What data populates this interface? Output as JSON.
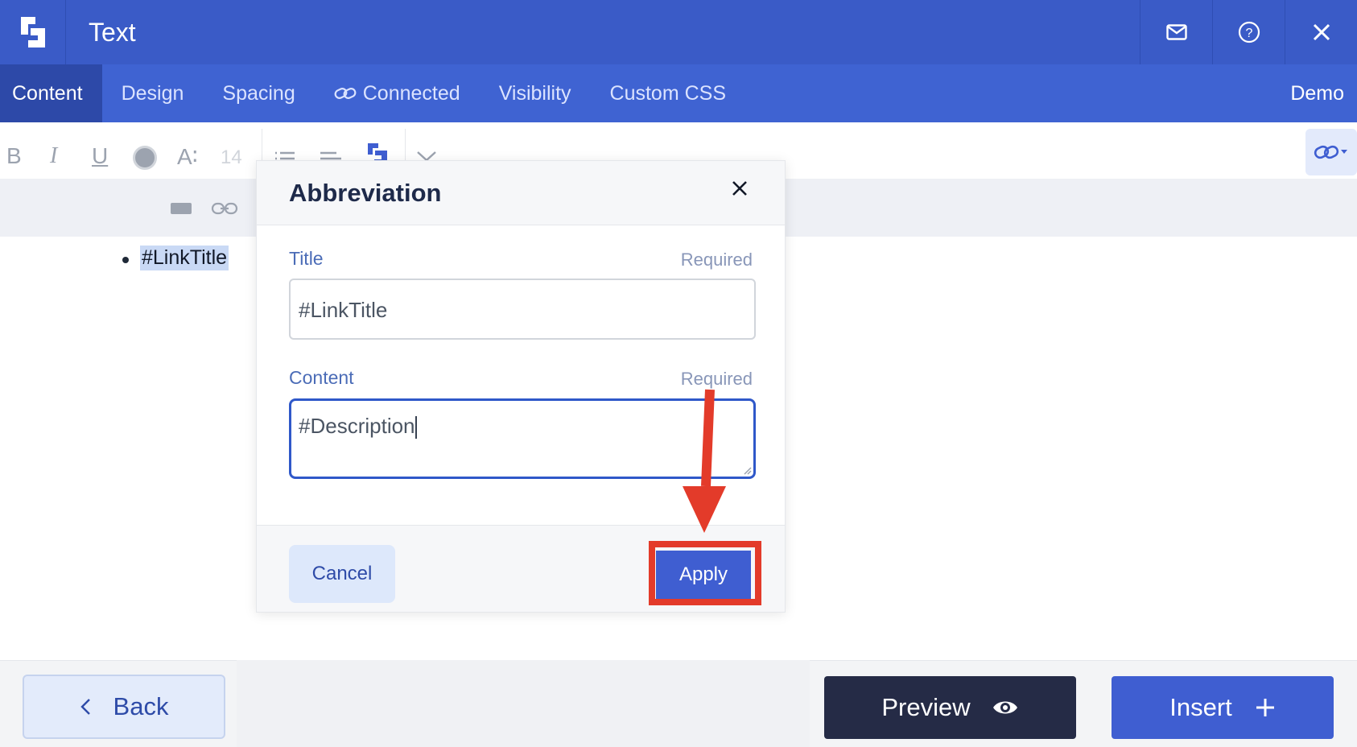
{
  "header": {
    "title": "Text"
  },
  "tabs": [
    {
      "label": "Content"
    },
    {
      "label": "Design"
    },
    {
      "label": "Spacing"
    },
    {
      "label": "Connected"
    },
    {
      "label": "Visibility"
    },
    {
      "label": "Custom CSS"
    }
  ],
  "tab_right": "Demo",
  "toolbar": {
    "bold": "B",
    "italic": "I",
    "underline": "U",
    "font_size_glyph": "A∶",
    "font_size_value": "14"
  },
  "editor": {
    "selected_text": "#LinkTitle"
  },
  "modal": {
    "title": "Abbreviation",
    "title_field": {
      "label": "Title",
      "required": "Required",
      "value": "#LinkTitle"
    },
    "content_field": {
      "label": "Content",
      "required": "Required",
      "value": "#Description"
    },
    "cancel_label": "Cancel",
    "apply_label": "Apply"
  },
  "footer": {
    "back_label": "Back",
    "preview_label": "Preview",
    "insert_label": "Insert"
  },
  "colors": {
    "header": "#3a5bc7",
    "tabbar": "#3f63d2",
    "primary_button": "#3f5ed1",
    "preview_button": "#252b46",
    "annotation": "#e33b2a"
  }
}
